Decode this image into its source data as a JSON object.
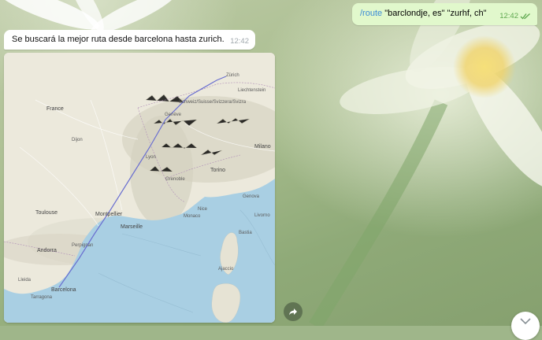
{
  "outgoing_message": {
    "command": "/route",
    "args": " \"barclondje, es\" \"zurhf, ch\"",
    "time": "12:42",
    "status_icon": "double-check-icon",
    "status_color": "#5fa84f"
  },
  "incoming_message": {
    "text": "Se buscará la mejor ruta desde barcelona hasta zurich.",
    "time": "12:42"
  },
  "map": {
    "route_color": "#6a6fd0",
    "water_color": "#a9cfe3",
    "labels": {
      "france": "France",
      "liechtenstein": "Liechtenstein",
      "switzerland": "Schweiz/Suisse/Svizzera/Svizra",
      "andorra": "Andorra",
      "barcelona": "Barcelona",
      "tarragona": "Tarragona",
      "lleida": "Lleida",
      "montpellier": "Montpellier",
      "marseille": "Marseille",
      "toulouse": "Toulouse",
      "lyon": "Lyon",
      "geneve": "Genève",
      "torino": "Torino",
      "milano": "Milano",
      "monaco": "Monaco",
      "genova": "Genova",
      "nice": "Nice",
      "bastia": "Bastia",
      "ajaccio": "Ajaccio",
      "perpignan": "Perpignan",
      "zurich": "Zürich",
      "grenoble": "Grenoble",
      "dijon": "Dijon",
      "livorno": "Livorno"
    }
  },
  "buttons": {
    "share_icon": "share-icon",
    "scroll_icon": "chevron-down-icon"
  }
}
